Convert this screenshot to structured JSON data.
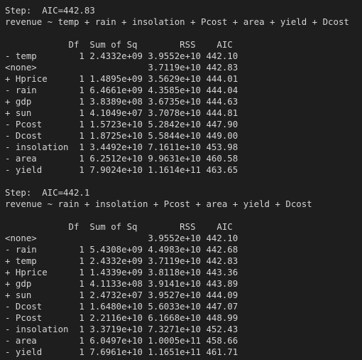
{
  "console": {
    "colors": {
      "background": "#1e1e1e",
      "text": "#d4d4d4"
    },
    "steps": [
      {
        "step_line": "Step:  AIC=442.83",
        "formula": "revenue ~ temp + rain + insolation + Pcost + area + yield + Dcost",
        "header": "            Df  Sum of Sq        RSS    AIC",
        "rows": [
          "- temp        1 2.4332e+09 3.9552e+10 442.10",
          "<none>                     3.7119e+10 442.83",
          "+ Hprice      1 1.4895e+09 3.5629e+10 444.01",
          "- rain        1 6.4661e+09 4.3585e+10 444.04",
          "+ gdp         1 3.8389e+08 3.6735e+10 444.63",
          "+ sun         1 4.1049e+07 3.7078e+10 444.81",
          "- Pcost       1 1.5723e+10 5.2842e+10 447.90",
          "- Dcost       1 1.8725e+10 5.5844e+10 449.00",
          "- insolation  1 3.4492e+10 7.1611e+10 453.98",
          "- area        1 6.2512e+10 9.9631e+10 460.58",
          "- yield       1 7.9024e+10 1.1614e+11 463.65"
        ]
      },
      {
        "step_line": "Step:  AIC=442.1",
        "formula": "revenue ~ rain + insolation + Pcost + area + yield + Dcost",
        "header": "            Df  Sum of Sq        RSS    AIC",
        "rows": [
          "<none>                     3.9552e+10 442.10",
          "- rain        1 5.4308e+09 4.4983e+10 442.68",
          "+ temp        1 2.4332e+09 3.7119e+10 442.83",
          "+ Hprice      1 1.4339e+09 3.8118e+10 443.36",
          "+ gdp         1 4.1133e+08 3.9141e+10 443.89",
          "+ sun         1 2.4732e+07 3.9527e+10 444.09",
          "- Dcost       1 1.6480e+10 5.6033e+10 447.07",
          "- Pcost       1 2.2116e+10 6.1668e+10 448.99",
          "- insolation  1 3.3719e+10 7.3271e+10 452.43",
          "- area        1 6.0497e+10 1.0005e+11 458.66",
          "- yield       1 7.6961e+10 1.1651e+11 461.71"
        ]
      }
    ]
  }
}
